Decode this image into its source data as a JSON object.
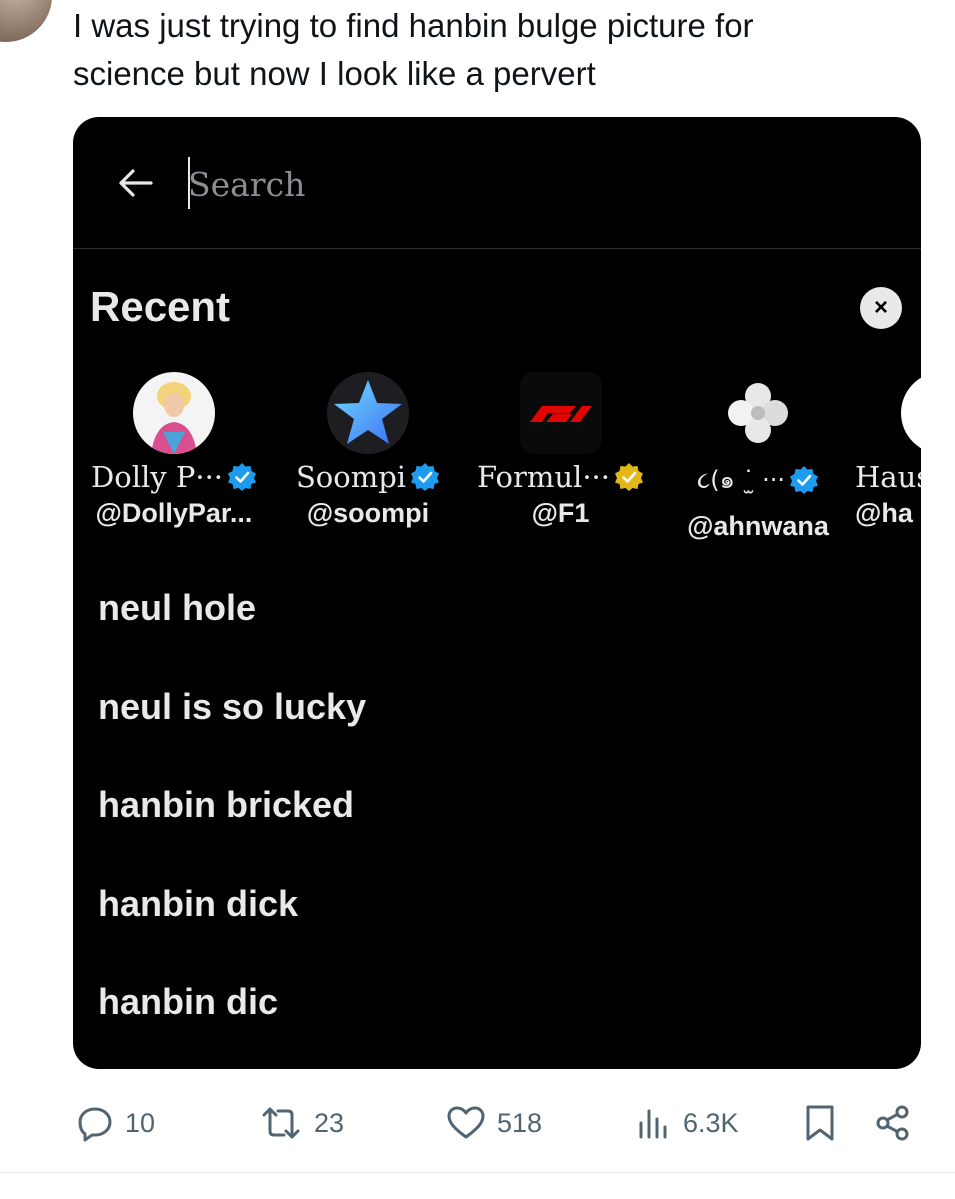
{
  "tweet": {
    "text_line1": "I was just trying to find hanbin bulge picture for",
    "text_line2": "science but now I look like a pervert"
  },
  "search": {
    "placeholder": "Search"
  },
  "recent": {
    "title": "Recent",
    "clear_label": "×",
    "accounts": [
      {
        "name": "Dolly P···",
        "handle": "@DollyPar...",
        "badge": "verified-blue"
      },
      {
        "name": "Soompi",
        "handle": "@soompi",
        "badge": "verified-blue"
      },
      {
        "name": "Formul···",
        "handle": "@F1",
        "badge": "verified-gold"
      },
      {
        "name": "૮(๑ ˙̫ ···",
        "handle": "@ahnwana",
        "badge": "verified-blue"
      },
      {
        "name": "Haus",
        "handle": "@ha",
        "badge": "none"
      }
    ],
    "searches": [
      "neul hole",
      "neul is so lucky",
      "hanbin bricked",
      "hanbin dick",
      "hanbin dic"
    ]
  },
  "metrics": {
    "replies": "10",
    "reposts": "23",
    "likes": "518",
    "views": "6.3K"
  },
  "colors": {
    "card_bg": "#000000",
    "verified_blue": "#1d9bf0",
    "verified_gold": "#e2b719",
    "f1_red": "#e10600",
    "icon_gray": "#536471"
  }
}
